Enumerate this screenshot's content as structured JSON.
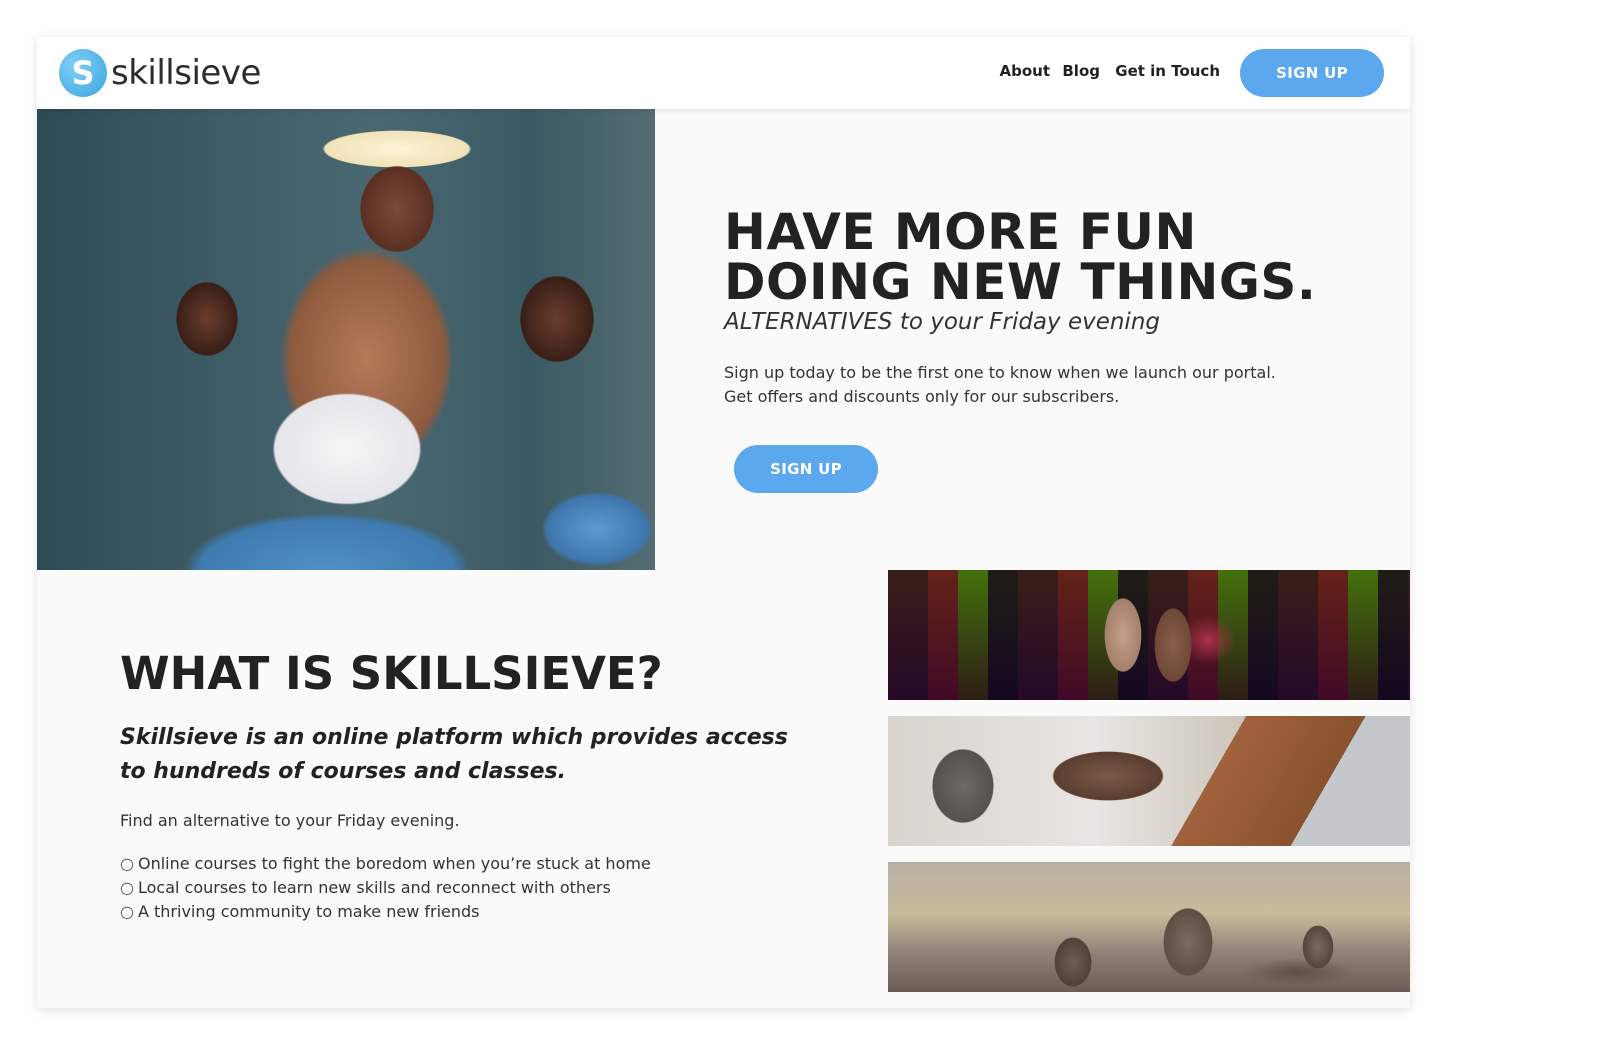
{
  "brand": {
    "logo_letter": "S",
    "name": "skillsieve",
    "accent_color": "#5ba8ee",
    "logo_color": "#3ba3de"
  },
  "nav": {
    "items": [
      {
        "label": "About"
      },
      {
        "label": "Blog"
      },
      {
        "label": "Get in Touch"
      }
    ],
    "signup_label": "SIGN UP"
  },
  "hero": {
    "title_line1": "HAVE MORE FUN",
    "title_line2": "DOING NEW THINGS.",
    "subtitle_em": "ALTERNATIVES",
    "subtitle_rest": " to your Friday evening",
    "desc_line1": "Sign up today to be the first one to know when we launch our portal.",
    "desc_line2": "Get offers and discounts only for our subscribers.",
    "cta_label": "SIGN UP"
  },
  "about": {
    "title": "WHAT IS SKILLSIEVE?",
    "lead": "Skillsieve is an online platform which provides access to hundreds of courses and classes.",
    "intro": "Find an alternative to your Friday evening.",
    "bullet_glyph": "○",
    "points": [
      "Online courses to fight the boredom when you’re stuck at home",
      "Local courses to learn new skills and reconnect with others",
      "A thriving community to make new friends"
    ]
  }
}
